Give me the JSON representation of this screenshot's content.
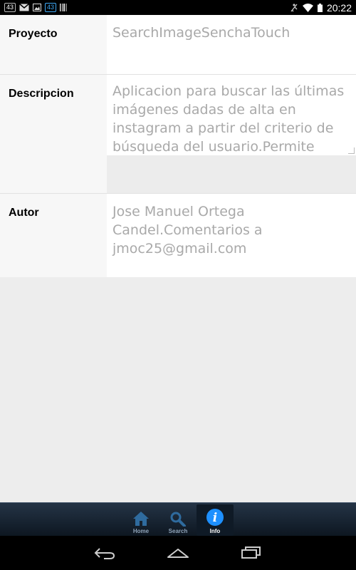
{
  "status_bar": {
    "badge1": "43",
    "badge2": "43",
    "time": "20:22"
  },
  "form": {
    "proyecto_label": "Proyecto",
    "proyecto_value": "SearchImageSenchaTouch",
    "descripcion_label": "Descripcion",
    "descripcion_value": "Aplicacion para buscar las últimas imágenes dadas de alta en instagram a partir del criterio de búsqueda del usuario.Permite visualizar las imágenes y los",
    "autor_label": "Autor",
    "autor_value": "Jose Manuel Ortega Candel.Comentarios a jmoc25@gmail.com"
  },
  "tabs": [
    {
      "label": "Home",
      "icon": "home-icon"
    },
    {
      "label": "Search",
      "icon": "search-icon"
    },
    {
      "label": "Info",
      "icon": "info-icon",
      "active": true
    }
  ],
  "colors": {
    "accent": "#1e90ff",
    "tabbar": "#1a2838",
    "value_text": "#a9a9a9"
  }
}
